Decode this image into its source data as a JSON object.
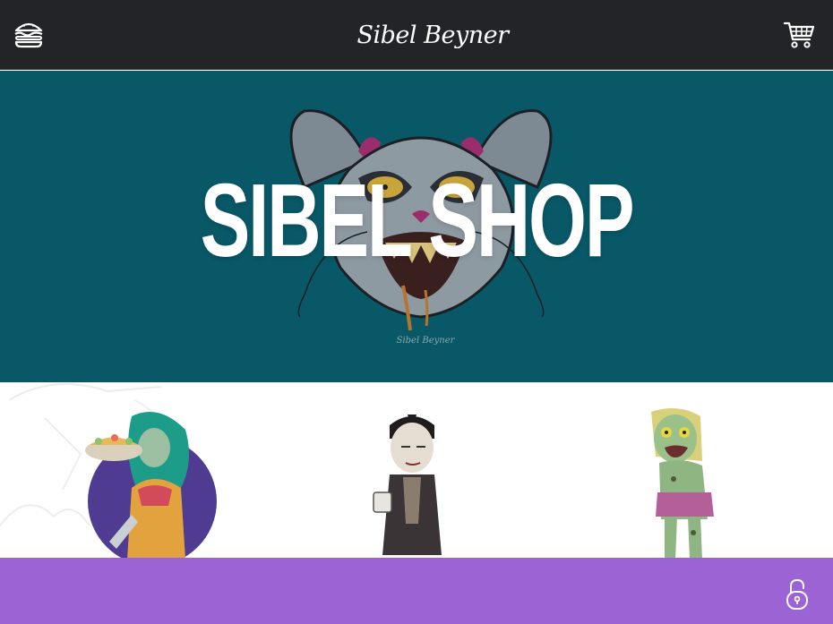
{
  "header": {
    "brand": "Sibel Beyner",
    "menu_icon": "hamburger-icon",
    "cart_icon": "shopping-cart-icon"
  },
  "hero": {
    "title": "SIBEL SHOP",
    "signature": "Sibel Beyner",
    "background_color": "#085867"
  },
  "products": {
    "items": [
      {
        "name": "chef-woman-illustration"
      },
      {
        "name": "vampire-illustration"
      },
      {
        "name": "zombie-illustration"
      }
    ]
  },
  "footer": {
    "lock_icon": "padlock-open-icon",
    "background_color": "#9b63d3"
  },
  "colors": {
    "topbar": "#222427",
    "accent_purple": "#9b63d3",
    "hero_teal": "#085867"
  }
}
